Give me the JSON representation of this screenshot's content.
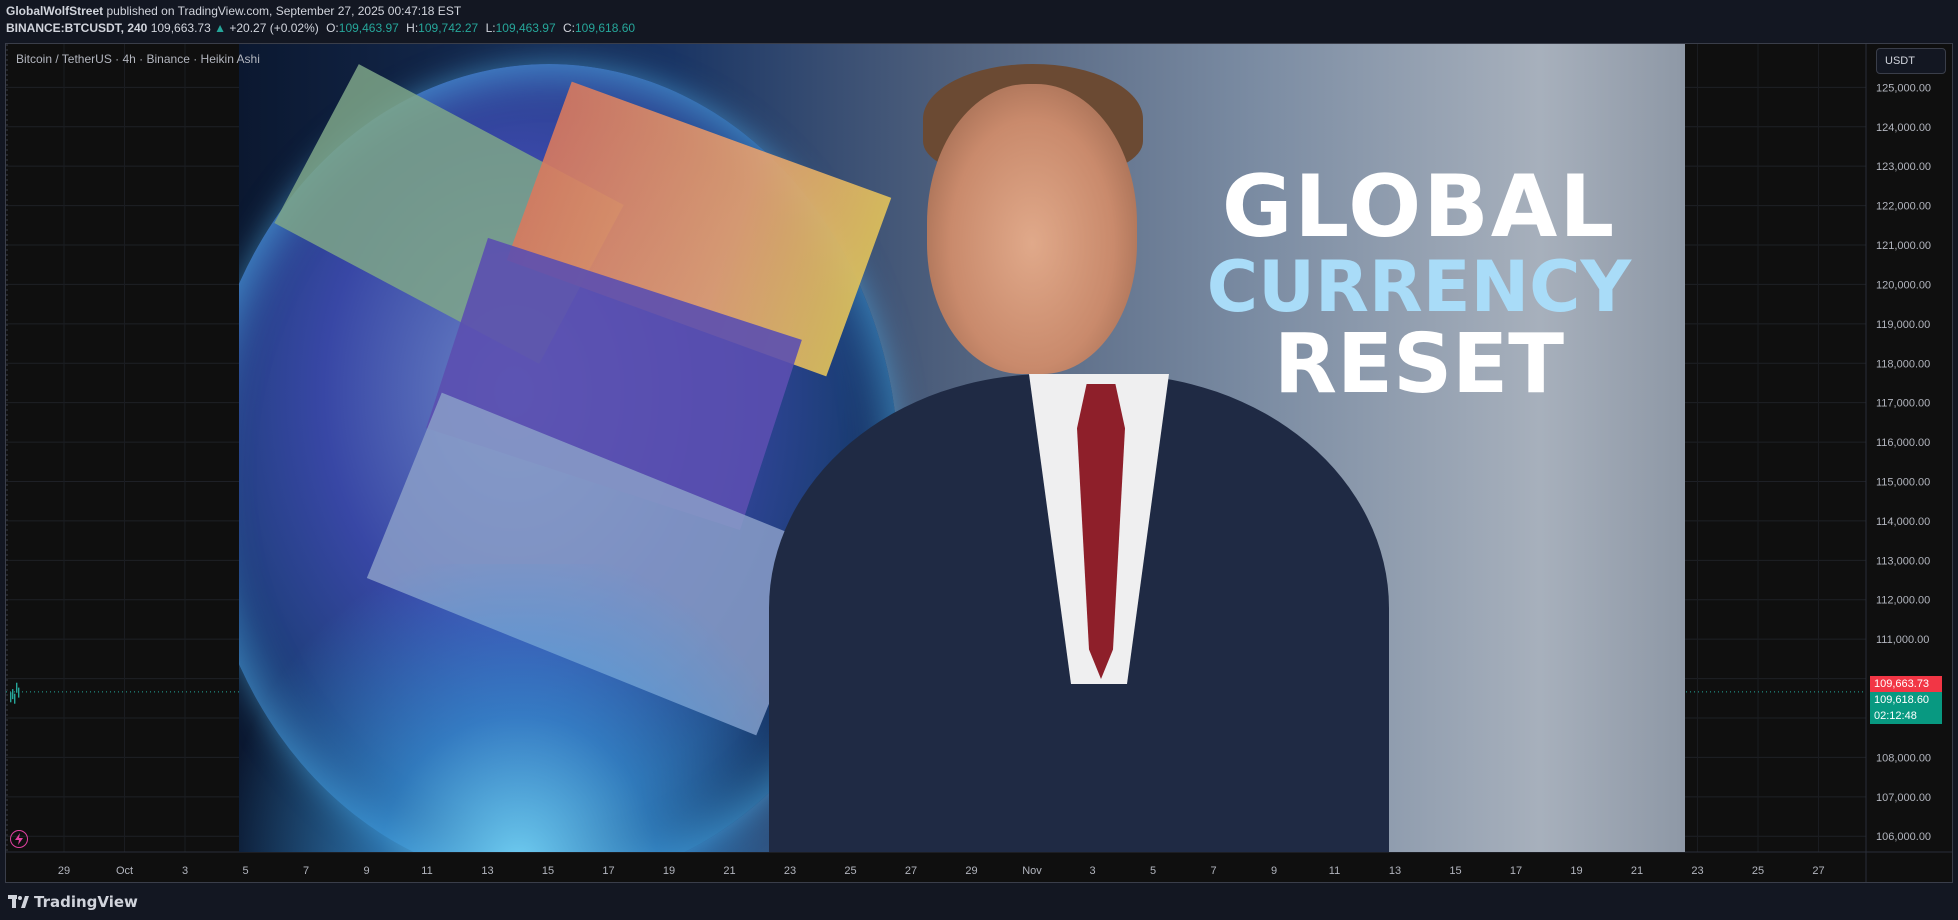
{
  "header": {
    "publisher": "GlobalWolfStreet",
    "published_text": "published on TradingView.com, September 27, 2025 00:47:18 EST",
    "symbol": "BINANCE:BTCUSDT, 240",
    "last": "109,663.73",
    "change": "+20.27 (+0.02%)",
    "o_label": "O:",
    "o": "109,463.97",
    "h_label": "H:",
    "h": "109,742.27",
    "l_label": "L:",
    "l": "109,463.97",
    "c_label": "C:",
    "c": "109,618.60"
  },
  "chart": {
    "title": "Bitcoin / TetherUS · 4h · Binance · Heikin Ashi",
    "currency": "USDT",
    "last_price_tag": "109,663.73",
    "close_price_tag": "109,618.60",
    "countdown_tag": "02:12:48",
    "colors": {
      "up": "#26a69a",
      "down": "#f23645",
      "grid": "#1f2125",
      "text": "#b2b5be"
    }
  },
  "overlay": {
    "headline_l1": "GLOBAL",
    "headline_l2": "CURRENCY",
    "headline_l3": "RESET"
  },
  "footer": {
    "logo_text": "TradingView"
  },
  "chart_data": {
    "type": "line",
    "title": "Bitcoin / TetherUS · 4h · Binance · Heikin Ashi",
    "xlabel": "",
    "ylabel": "",
    "ylim": [
      105600,
      126100
    ],
    "y_ticks": [
      106000,
      107000,
      108000,
      109000,
      110000,
      111000,
      112000,
      113000,
      114000,
      115000,
      116000,
      117000,
      118000,
      119000,
      120000,
      121000,
      122000,
      123000,
      124000,
      125000
    ],
    "y_tick_labels": [
      "106,000.00",
      "107,000.00",
      "108,000.00",
      "",
      "",
      "111,000.00",
      "112,000.00",
      "113,000.00",
      "114,000.00",
      "115,000.00",
      "116,000.00",
      "117,000.00",
      "118,000.00",
      "119,000.00",
      "120,000.00",
      "121,000.00",
      "122,000.00",
      "123,000.00",
      "124,000.00",
      "125,000.00"
    ],
    "x_tick_labels": [
      "29",
      "Oct",
      "3",
      "5",
      "7",
      "9",
      "11",
      "13",
      "15",
      "17",
      "19",
      "21",
      "23",
      "25",
      "27",
      "29",
      "Nov",
      "3",
      "5",
      "7",
      "9",
      "11",
      "13",
      "15",
      "17",
      "19",
      "21",
      "23",
      "25",
      "27"
    ],
    "price_line": 109663.73,
    "series": [
      {
        "values": [
          109500,
          109580,
          109463.97,
          109742.27,
          109618.6
        ]
      }
    ]
  }
}
